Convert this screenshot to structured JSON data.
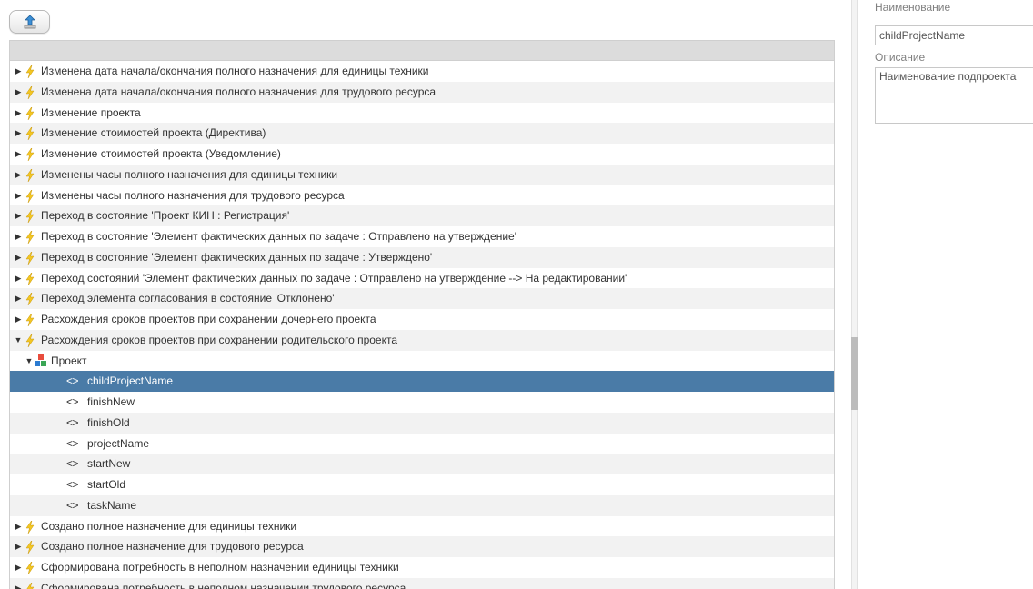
{
  "toolbar": {
    "upload_icon": "upload-icon"
  },
  "tree": {
    "events_before": [
      "Изменена дата начала/окончания полного назначения для единицы техники",
      "Изменена дата начала/окончания полного назначения для трудового ресурса",
      "Изменение проекта",
      "Изменение стоимостей проекта (Директива)",
      "Изменение стоимостей проекта (Уведомление)",
      "Изменены часы полного назначения для единицы техники",
      "Изменены часы полного назначения для трудового ресурса",
      "Переход в состояние 'Проект КИН : Регистрация'",
      "Переход в состояние 'Элемент фактических данных по задаче : Отправлено на утверждение'",
      "Переход в состояние 'Элемент фактических данных по задаче : Утверждено'",
      "Переход состояний 'Элемент фактических данных по задаче : Отправлено на утверждение --> На редактировании'",
      "Переход элемента согласования в состояние 'Отклонено'",
      "Расхождения сроков проектов при сохранении дочернего проекта"
    ],
    "expanded_event": "Расхождения сроков проектов при сохранении родительского проекта",
    "expanded_group": "Проект",
    "fields": [
      "childProjectName",
      "finishNew",
      "finishOld",
      "projectName",
      "startNew",
      "startOld",
      "taskName"
    ],
    "selected_field_index": 0,
    "events_after": [
      "Создано полное назначение для единицы техники",
      "Создано полное назначение для трудового ресурса",
      "Сформирована потребность в неполном назначении единицы техники",
      "Сформирована потребность в неполном назначении трудового ресурса"
    ],
    "event_icon": "lightning-icon",
    "group_icon": "project-blocks-icon",
    "field_icon": "code-brackets-icon"
  },
  "properties": {
    "name_label": "Наименование",
    "name_value": "childProjectName",
    "description_label": "Описание",
    "description_value": "Наименование подпроекта"
  },
  "colors": {
    "selected_row": "#4a7ba7",
    "alt_row": "#f2f2f2",
    "lightning": "#f3c623"
  }
}
